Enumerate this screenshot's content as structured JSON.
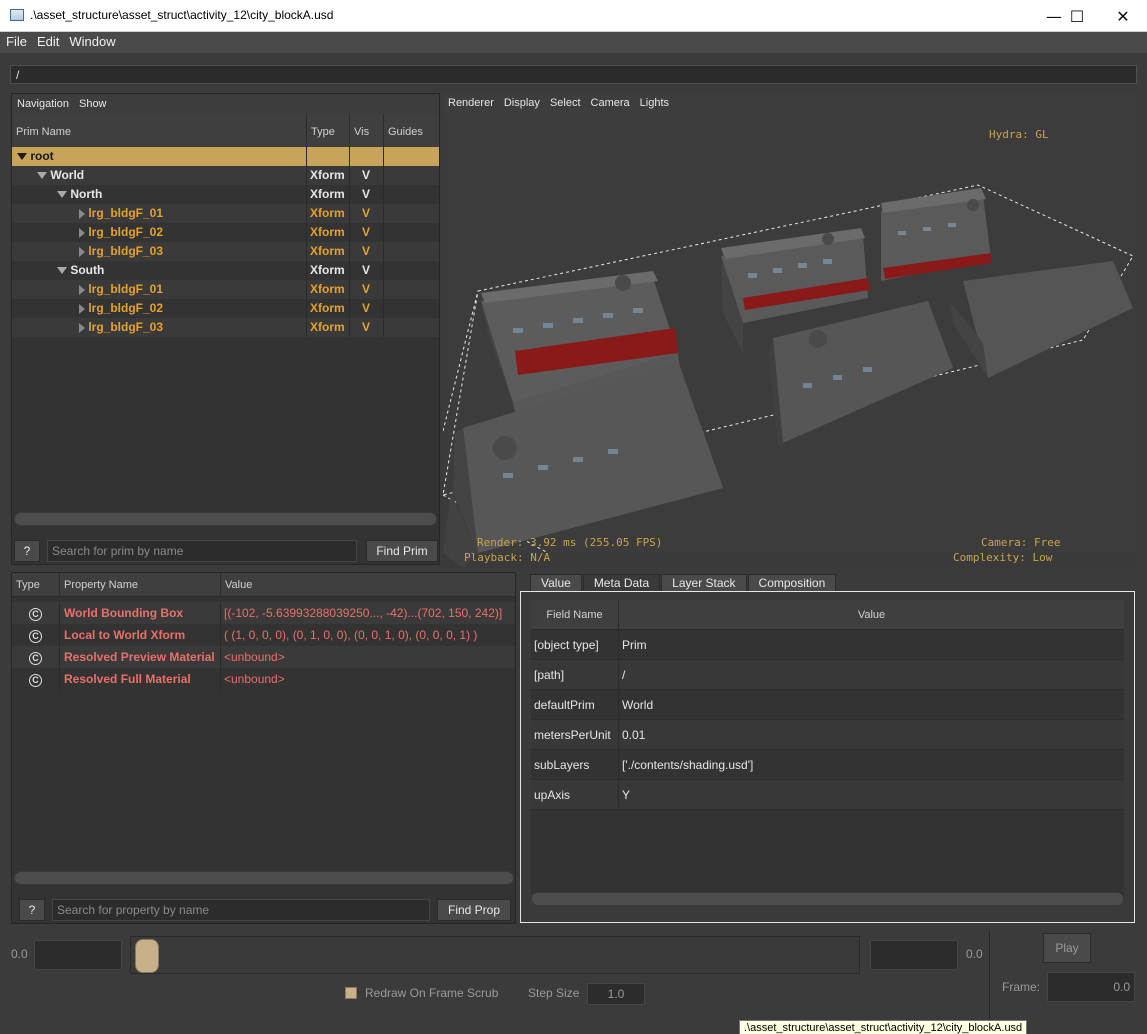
{
  "window": {
    "title": ".\\asset_structure\\asset_struct\\activity_12\\city_blockA.usd",
    "minimize": "—",
    "maximize": "☐",
    "close": "✕"
  },
  "menu": [
    "File",
    "Edit",
    "Window"
  ],
  "path": "/",
  "outliner": {
    "toolbar": [
      "Navigation",
      "Show"
    ],
    "columns": [
      "Prim Name",
      "Type",
      "Vis",
      "Guides"
    ],
    "rows": [
      {
        "name": "root",
        "type": "",
        "vis": ""
      },
      {
        "name": "World",
        "type": "Xform",
        "vis": "V"
      },
      {
        "name": "North",
        "type": "Xform",
        "vis": "V"
      },
      {
        "name": "lrg_bldgF_01",
        "type": "Xform",
        "vis": "V"
      },
      {
        "name": "lrg_bldgF_02",
        "type": "Xform",
        "vis": "V"
      },
      {
        "name": "lrg_bldgF_03",
        "type": "Xform",
        "vis": "V"
      },
      {
        "name": "South",
        "type": "Xform",
        "vis": "V"
      },
      {
        "name": "lrg_bldgF_01",
        "type": "Xform",
        "vis": "V"
      },
      {
        "name": "lrg_bldgF_02",
        "type": "Xform",
        "vis": "V"
      },
      {
        "name": "lrg_bldgF_03",
        "type": "Xform",
        "vis": "V"
      }
    ],
    "help_label": "?",
    "search_placeholder": "Search for prim by name",
    "find_label": "Find Prim"
  },
  "viewport": {
    "menu": [
      "Renderer",
      "Display",
      "Select",
      "Camera",
      "Lights"
    ],
    "hydra": "Hydra: GL",
    "render": "Render: 3.92 ms (255.05 FPS)",
    "playback": "Playback: N/A",
    "camera": "Camera: Free",
    "complexity": "Complexity: Low"
  },
  "properties": {
    "columns": [
      "Type",
      "Property Name",
      "Value"
    ],
    "rows": [
      {
        "name": "World Bounding Box",
        "value": "[(-102, -5.63993288039250..., -42)...(702, 150, 242)]"
      },
      {
        "name": "Local to World Xform",
        "value": "( (1, 0, 0, 0), (0, 1, 0, 0), (0, 0, 1, 0), (0, 0, 0, 1) )"
      },
      {
        "name": "Resolved Preview Material",
        "value": "<unbound>"
      },
      {
        "name": "Resolved Full Material",
        "value": "<unbound>"
      }
    ],
    "type_glyph": "C",
    "help_label": "?",
    "search_placeholder": "Search for property by name",
    "find_label": "Find Prop"
  },
  "metadata": {
    "tabs": [
      "Value",
      "Meta Data",
      "Layer Stack",
      "Composition"
    ],
    "columns": [
      "Field Name",
      "Value"
    ],
    "rows": [
      {
        "field": "[object type]",
        "value": "Prim"
      },
      {
        "field": "[path]",
        "value": "/"
      },
      {
        "field": "defaultPrim",
        "value": "World"
      },
      {
        "field": "metersPerUnit",
        "value": "0.01"
      },
      {
        "field": "subLayers",
        "value": "['./contents/shading.usd']"
      },
      {
        "field": "upAxis",
        "value": "Y"
      }
    ]
  },
  "timeline": {
    "start_label": "0.0",
    "end_label": "0.0",
    "play_label": "Play",
    "redraw_label": "Redraw On Frame Scrub",
    "step_label": "Step Size",
    "step_value": "1.0",
    "frame_label": "Frame:",
    "frame_value": "0.0"
  },
  "tooltip": ".\\asset_structure\\asset_struct\\activity_12\\city_blockA.usd",
  "colors": {
    "prim_orange": "#e6a12d",
    "property_red": "#e8706a",
    "selection": "#c8a35a",
    "hud_text": "#c9a44a"
  }
}
